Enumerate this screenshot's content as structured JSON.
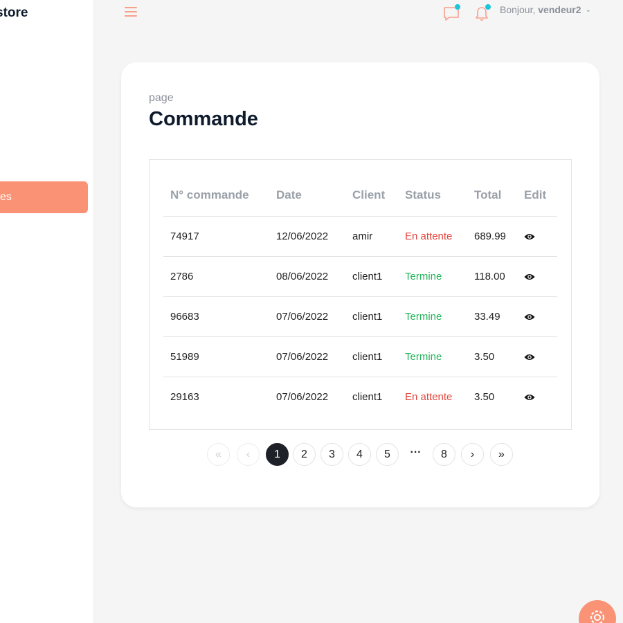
{
  "sidebar": {
    "brand": "store",
    "active_item": "es"
  },
  "header": {
    "greeting_prefix": "Bonjour, ",
    "username": "vendeur2"
  },
  "page": {
    "subtitle": "page",
    "title": "Commande"
  },
  "table": {
    "headers": [
      "N° commande",
      "Date",
      "Client",
      "Status",
      "Total",
      "Edit"
    ],
    "rows": [
      {
        "id": "74917",
        "date": "12/06/2022",
        "client": "amir",
        "status": "En attente",
        "total": "689.99"
      },
      {
        "id": "2786",
        "date": "08/06/2022",
        "client": "client1",
        "status": "Termine",
        "total": "118.00"
      },
      {
        "id": "96683",
        "date": "07/06/2022",
        "client": "client1",
        "status": "Termine",
        "total": "33.49"
      },
      {
        "id": "51989",
        "date": "07/06/2022",
        "client": "client1",
        "status": "Termine",
        "total": "3.50"
      },
      {
        "id": "29163",
        "date": "07/06/2022",
        "client": "client1",
        "status": "En attente",
        "total": "3.50"
      }
    ]
  },
  "pagination": {
    "first": "«",
    "prev": "‹",
    "pages": [
      "1",
      "2",
      "3",
      "4",
      "5"
    ],
    "ellipsis": "···",
    "last_page": "8",
    "next": "›",
    "last": "»",
    "current": "1"
  },
  "icons": {
    "menu": "hamburger-icon",
    "chat": "chat-icon",
    "bell": "bell-icon",
    "view": "eye-icon",
    "settings": "gear-icon"
  },
  "colors": {
    "accent": "#fa9275",
    "notification_dot": "#1cc6d8",
    "status_waiting": "#e0463d",
    "status_done": "#25b35b"
  }
}
